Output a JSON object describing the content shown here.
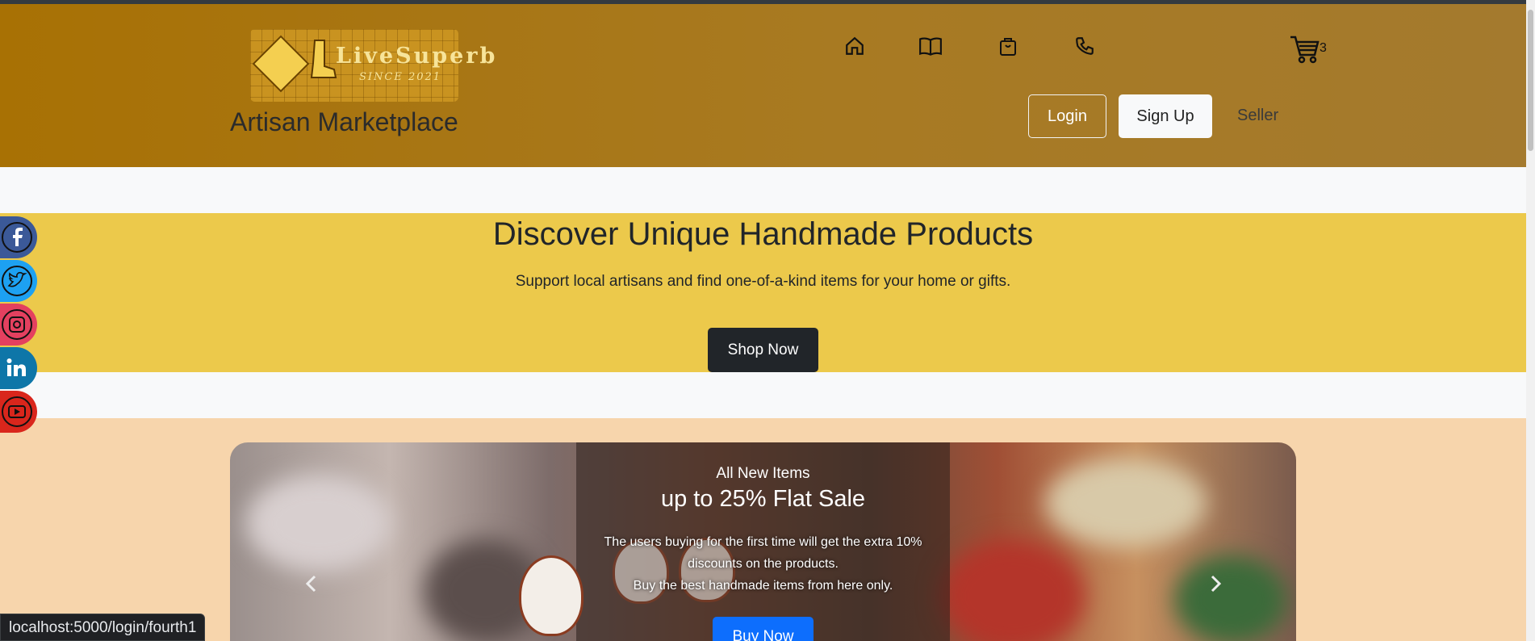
{
  "header": {
    "logo_text": "LiveSuperb",
    "logo_since": "SINCE 2021",
    "brand_name": "Artisan Marketplace",
    "nav_icons": [
      "home-icon",
      "book-icon",
      "bag-icon",
      "phone-icon"
    ],
    "cart_count": "3",
    "login_label": "Login",
    "signup_label": "Sign Up",
    "seller_label": "Seller"
  },
  "hero": {
    "title": "Discover Unique Handmade Products",
    "subtitle": "Support local artisans and find one-of-a-kind items for your home or gifts.",
    "cta_label": "Shop Now"
  },
  "carousel": {
    "kicker": "All New Items",
    "headline": "up to 25% Flat Sale",
    "body_line1": "The users buying for the first time will get the extra 10% discounts on the products.",
    "body_line2": "Buy the best handmade items from here only.",
    "cta_label": "Buy Now"
  },
  "social": [
    "facebook-icon",
    "twitter-icon",
    "instagram-icon",
    "linkedin-icon",
    "youtube-icon"
  ],
  "status_bar": {
    "url": "localhost:5000/login/fourth1"
  },
  "colors": {
    "header_gold": "#a87104",
    "hero_yellow": "#ecc94b",
    "promo_peach": "#f7d5ac",
    "buy_blue": "#0d6efd",
    "facebook": "#3b5998",
    "twitter": "#1da1f2",
    "instagram": "#e4405f",
    "linkedin": "#0e76a8",
    "youtube": "#d9261c"
  }
}
